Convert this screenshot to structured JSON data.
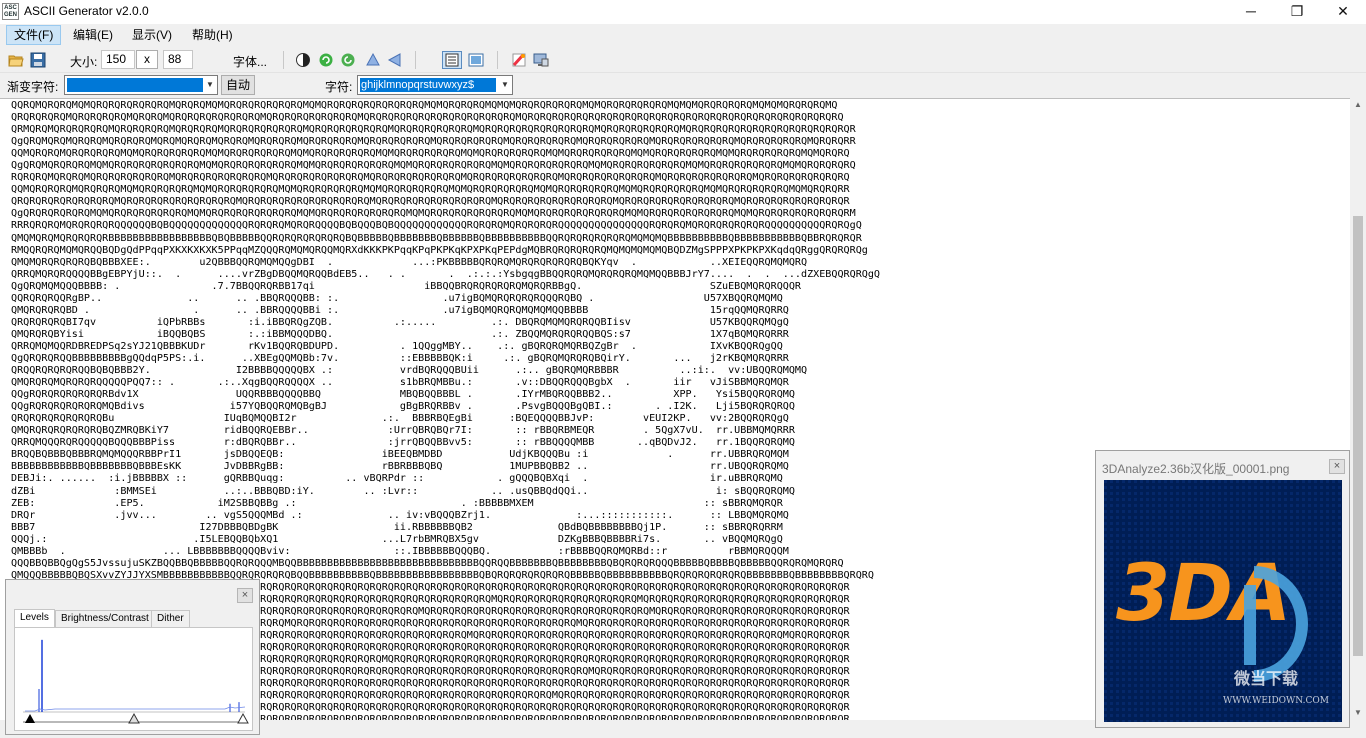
{
  "window": {
    "title": "ASCII Generator v2.0.0",
    "app_icon_text": "ASC GEN",
    "minimize": "─",
    "restore": "❐",
    "close": "✕"
  },
  "menu": {
    "file": "文件(F)",
    "edit": "编辑(E)",
    "view": "显示(V)",
    "help": "帮助(H)"
  },
  "toolbar": {
    "size_label": "大小:",
    "width": "150",
    "x_button": "x",
    "height": "88",
    "font_button": "字体..."
  },
  "toolbar2": {
    "ramp_label": "渐变字符:",
    "ramp_value": "",
    "auto_button": "自动",
    "chars_label": "字符:",
    "chars_value": "ghijklmnopqrstuvwxyz$"
  },
  "ascii": {
    "lines": [
      "QQRQMQRQRQMQMQRQRQRQRQRQRQMQRQRQMQMQRQRQRQRQRQRQMQMQRQRQRQRQRQRQRQRQMQMQRQRQRQMQMQMQRQRQRQRQRQMQMQRQRQRQRQRQMQMQMQRQRQRQRQMQMQMQRQRQRQMQ",
      "QRQRQRQRQMQRQRQRQRQMQRQRQMQRQRQRQRQRQRQRQMQRQRQRQRQRQRQRQMQRQRQRQRQRQRQRQRQRQRQRQRQMQRQRQRQRQRQRQRQRQRQRQRQRQRQRQRQRQRQRQRQRQRQRQRQRQRQRQ",
      "QRMQRQMQRQRQRQRQMQRQRQRQRQMQRQRQRQMQRQRQRQRQRQRQMQRQRQRQRQRQRQMQRQRQRQRQRQRQMQRQRQRQRQRQRQRQRQRQMQRQRQRQRQRQRQMQRQRQRQRQRQRQRQRQRQRQRQRQRQR",
      "QgQRQMQRQMQRQRQMQRQRQRQMQRQMQRQRQMQRQRQMQRQRQRQMQRQRQRQRQMQRQRQRQRQRQMQRQRQRQRQRQMQRQRQRQRQRQMQRQRQRQRQRQMQRQRQRQRQRQRQMQRQRQRQRQRQMQRQRQRR",
      "QQMQRQRQMQRQRQRQRQMQMQRQRQRQRQRQMQMQRQRQRQRQRQMQMQRQRQRQRQRQMQMQRQRQRQRQRQMQMQRQRQRQRQRQMQMQRQRQRQRQRQMQMQRQRQRQRQRQMQMQRQRQRQRQRQMQMQRQRQ",
      "QgQRQMQRQRQRQMQMQRQRQRQRQRQRQRQMQMQRQRQRQRQRQRQMQMQRQRQRQRQRQRQMQMQRQRQRQRQRQRQMQMQRQRQRQRQRQRQMQMQRQRQRQRQRQRQMQMQRQRQRQRQRQRQMQMQRQRQRQRQ",
      "RQRQRQMQRQRQMQRQRQRQRQRQRQMQRQRQRQRQRQRQRQMQRQRQRQRQRQRQRQMQRQRQRQRQRQRQRQMQRQRQRQRQRQRQRQMQRQRQRQRQRQRQRQMQRQRQRQRQRQRQRQMQRQRQRQRQRQRQRQ",
      "QQMQRQRQRQMQRQRQRQMQMQRQRQRQRQMQMQRQRQRQRQRQMQMQRQRQRQRQRQMQMQRQRQRQRQRQMQMQRQRQRQRQRQMQMQRQRQRQRQRQMQMQRQRQRQRQRQMQMQRQRQRQRQRQMQMQRQRQRR",
      "QRQRQRQRQRQRQRQRQMQRQRQRQRQRQRQRQRQRQMQRQRQRQRQRQRQRQRQRQRQMQRQRQRQRQRQRQRQRQRQMQRQRQRQRQRQRQRQRQRQMQRQRQRQRQRQRQRQRQRQMQRQRQRQRQRQRQRQRQR",
      "QgQRQRQRQRQRQMQMQRQRQRQRQRQRQMQMQRQRQRQRQRQRQRQMQMQRQRQRQRQRQRQRQMQMQRQRQRQRQRQRQRQMQMQRQRQRQRQRQRQRQMQMQRQRQRQRQRQRQRQMQMQRQRQRQRQRQRQRQRM",
      "RRRQRQRQMQRQRQRQRQQQQQQBQBQQQQQQQQQQQQQRQRQRQMQRQRQQQQBQBQQQBQBQQQQQQQQQQQQRQRQRQMQRQRQRQRQQQQQQQQQQQQQQQRQRQRQMQRQRQRQRQRQRQQQQQQQQQQRQRQgQ",
      "QMQMQRQMQRQRQRQRBBBBBBBBBBBBBBBBBQBQBBBBBQQRQRQRQRQRQRQBQBBBBBQBBBBBBBQBBBBBBQBBBBBBBBBBQQRQRQRQRQRQRQMQMQMQBBBBBBBBBBQBBBBBBBBBBBQBBRQRQRQR",
      "RMQQRQRQMQMQRQQBQDgQdPPqqPXKXKXKXK5PPqqMZQQQRQMQMQRQQMQRXdKKKPKPqqKPqPKPKqKPXPKqPEPdgMQBRQRQRQRQRQMQMQMQMQMQBQDZMgSPPPXPKPKPXKqdqQRggQRQRQRQg",
      "QMQMQRQRQRQRQBQBBBXEE:.        u2QBBBQQRQMQMQQgDBI  .             ...:PKBBBBBQRQRQMQRQRQRQRQRQBQKYqv  .            ..XEIEQQRQMQMQRQ",
      "QRRQMQRQRQQQQBBgEBPYjU::.  .      ....vrZBgDBQQMQRQQBdEB5..   . .       .  .:.:.:YsbgqgBBQQRQRQMQRQRQRQMQMQQBBBJrY7....  .  .  ...dZXEBQQRQRQgQ",
      "QgQRQMQMQQQBBBB: .               .7.7BBQQRQRBB17qi                  iBBQQBRQRQRQRQRQMQRQRBBgQ.                     SZuEBQMQRQRQQQR",
      "QQRQRQRQQRgBP..              ..      .. .BBQRQQQBB: :.                 .u7igBQMQRQRQRQRQQQRQBQ .                  U57XBQQRQMQMQ",
      "QMQRQRQRQBD .                 .      .. .BBRQQQQBBi :.                 .u7igBQMQRQRQMQMQMQQBBBB                    15rqQQMQRQRRQ",
      "QRQRQRQRQBI7qv          iQPbRBBs       :i.iBBQRQgZQB.          .:.....         .:. DBQRQMQMQRQRQQBIisv             U57KBQQRQMQgQ",
      "QMQRQRQBYisi            iBQQBQBS       :.:iBBMQQQDBQ.                          .:. ZBQQMQRQRQRQQBQS:s7             1X7qBQMQRQRRR",
      "QRRQMQMQQRDBREDPSq2sYJ21QBBBKUDr       rKv1BQQRQBDUPD.          . 1QQggMBY..    .:. gBQRQRQMQRBQZgBr  .            IXvKBQQRQgQQ",
      "QgQRQRQRQQBBBBBBBBBgQQdqP5PS:.i.      ..XBEgQQMQBb:7v.          ::EBBBBBQK:i     .:. gBQRQMQRQRQBQirY.       ...   j2rKBQMQRQRRR",
      "QRQQRQRQRQRQQBQBQBBB2Y.              I2BBBBQQQQQBX .:           vrdBQRQQQBUii      .:.. gBQRQMQRBBBR          ..:i:.  vv:UBQQRQMQMQ",
      "QMQRQRQMQRQRQRQQQQQPQQ7:: .       .:..XqgBQQRQQQQX ..           s1bBRQMBBu.:       .v::DBQQRQQQBgbX  .       iir   vJiSBBMQRQMQR",
      "QQgRQRQRQRQRQRQRBdv1X                UQQRBBBQQQQBBQ             MBQBQQBBBL .       .IYrMBQRQQBBB2..          XPP.   Ysi5BQQRQRQMQ",
      "QQgRQRQRQRQRQRQMQBdivs              i57YQBQQRQMQBgBJ            gBgBRQRBBv .       .PsvgBQQQBgQBI.:       . .I2K.   Lji5BQRQRQRQQ",
      "QRQRQRQRQRQRQRQBu                  IUqBQMQQBI2r              .:.  BBBRBQEgBi      :BQEQQQQBBJvP:        vEUI2KP.   vv:2BQQRQRQgQ",
      "QMQRQRQRQRQRQRQBQZMRQBKiY7         ridBQQRQEBBr..             :UrrQBRQBQr7I:       :: rBBQRBMEQR        . 5QgX7vU.  rr.UBBMQMQRRR",
      "QRRQMQQQRQRQQQQQBQQQBBBPiss        r:dBQRQBBr..               :jrrQBQQBBvv5:       :: rBBQQQQMBB       ..qBQDvJ2.   rr.1BQQRQRQMQ",
      "BRQQBQBBBQBBBRQMQMQQQRBBPrI1       jsDBQQEQB:                iBEEQBMDBD           UdjKBQQQBu :i             .      rr.UBBRQRQMQM",
      "BBBBBBBBBBBBQBBBBBBBQBBBEsKK       JvDBBRgBB:                rBBRBBBQBQ           1MUPBBQBB2 ..                    rr.UBQQRQRQMQ",
      "DEBJi:. ......  :i.jBBBBBX ::      gQRBBQuqg:          .. vBQRPdr ::            . gQQQBQBXqi  .                    ir.uBBRQRQMQ",
      "dZBi             :BMMSEi           ..:..BBBQBD:iY.        .. :Lvr::            .. .usQBBQdQQi..                     i: sBQQRQRQMQ",
      "ZEB:             .EP5.            iM2SBBQBBg .:                           . :BBBBBMXEM                            :: sBBRQMQRQR",
      "DRQr             .jvv...        .. vgS5QQQMBd .:              .. iv:vBQQQBZrj1.              :...:::::::::::.      :: LBBQMQRQMQ",
      "BBB7                           I27DBBBQBDgBK                   ii.RBBBBBBQB2              QBdBQBBBBBBBBQj1P.      :: sBBRQRQRRM",
      "QQQj.:                        .I5LEBQQBQbXQ1                 ...L7rbBMRQBX5gv             DZKgBBBQBBBBRi7s.       .. vBQQMQRQgQ",
      "QMBBBb  .                ... LBBBBBBBQQQQBviv:                 ::.IBBBBBBQQQBQ.           :rBBBBQQRQMQRBd::r          rBBMQRQQQM",
      "QQQBBQBBQgQgS5JvssujuSKZBQQBBQBBBBBQQRQRQQQMBQQBBBBBBBBBBBBBBBBBBBBBBBBBBBBBBQQRQQBBBBBBBQBBBBBBBBQBQRQRQRQQQBBBBBQBBBBQBBBBBQQRQRQMQRQRQ",
      "QMQQQBBBBBQBQSXvvZYJJYXSMBBBBBBBBBBBQQRQRQRQRQBQQBBBBBBBBBBQBBBBBBBBBBBBBBBBBQBQRQRQRQRQRQRQBBBBBQBBBBBBBBBBQRQRQRQRQRQRQBBBBBBBQBBBBBBBBQRQRQ",
      "QRQRQRQRQRQRQRQRQRQRQRQRQRQRQRQRQRQRQRQRQRQRQRQRQRQRQRQRQRQRQRQRQRQRQRQRQRQRQRQRQRQRQRQRQRQRQRQRQRQRQRQRQRQRQRQRQRQRQRQRQRQRQRQRQRQRQRQRQR",
      "QRQRQMQRQRQRQRQRQRQRQRQRQRQMQRQRQRQRQRQRQRQRQRQRQRQRQRQRQRQRQRQRQRQRQRQRQRQRQRQMQRQRQRQRQRQRQRQRQRQRQRQMQRQRQRQRQRQRQRQRQRQRQRQRQRQRQRQRQR",
      "QRQRQRQRQMQRQRQRQRQRQRQRQRQRQRQMQRQRQRQRQRQRQRQRQRQRQRQRQRQRQRQRQRQMQRQRQRQRQRQRQRQRQRQRQRQRQRQRQRQRQRQRQMQRQRQRQRQRQRQRQRQRQRQRQRQRQRQRQR",
      "QRQRQRQRQRQRQRQMQRQRQRQRQRQRQRQRQRQRQRQRQRQRQMQRQRQRQRQRQRQRQRQRQRQRQRQRQRQRQRQRQRQRQRQRQRQRQMQRQRQRQRQRQRQRQRQRQRQRQRQRQRQRQRQRQRQRQRQRQR",
      "QRQRQRQRQRQRQRQRQRQRQRQMQRQRQRQRQRQRQRQRQRQRQRQRQRQRQRQRQRQRQRQRQRQRQRQRQRQMQRQRQRQRQRQRQRQRQRQRQRQRQRQRQRQRQRQRQRQRQRQRQRQRQRQMQRQRQRQRQR",
      "QRQRQRQRQRQRQRQRQRQRQRQRQRQRQRQRQRQMQRQRQRQRQRQRQRQRQRQRQRQRQRQRQRQRQRQRQRQRQRQRQRQRQRQRQRQRQRQRQRQRQRQRQRQRQRQRQRQRQRQRQRQRQRQRQRQRQRQRQR",
      "QRQRQRQRQRQRQMQRQRQRQRQRQRQRQRQRQRQRQRQRQRQRQRQRQRQRQRQRQRQRQMQRQRQRQRQRQRQRQRQRQRQRQRQRQRQRQRQRQRQRQRQRQRQRQRQRQRQRQRQRQRQRQRQRQRQRQRQRQR",
      "QRQRQRQRQRQRQRQRQRQRQRQRQRQRQRQRQRQRQRQRQRQRQRQRQRQRQRQRQRQRQRQRQRQRQRQRQRQRQRQRQRQRQRQRQRQRQRQMQRQRQRQRQRQRQRQRQRQRQRQRQRQRQRQRQRQRQRQRQR",
      "QRQRQRQRQRQRQRQRQRQRQRQRQRQMQRQRQRQRQRQRQRQRQRQRQRQRQRQRQRQRQRQRQRQRQRQRQRQRQRQRQRQRQRQRQRQRQRQRQRQRQRQRQRQRQRQRQRQRQRQRQRQRQRQRQRQRQRQRQR",
      "QRQRQRQRQRQRQRQRQRQRQRQRQRQRQRQRQRQRQRQRQRQRQRQRQRQRQRQRQRQRQRQRQRQRQRQRQRQRQRQRQRQRQRQRQMQRQRQRQRQRQRQRQRQRQRQRQRQRQRQRQRQRQRQRQRQRQRQRQR",
      "QRQRQRQRQRQRQRQRQRQRQRQRQRQRQRQRQRQRQRQRQRQRQRQRQRQRQRQRQRQRQRQRQRQRQRQRQRQRQRQRQRQRQRQRQRQRQRQRQRQRQRQRQRQRQRQRQRQRQRQRQRQRQRQRQRQRQRQRQR",
      "QRQRQRQRQRQRQRQRQRQRQRQRQRQRQRQRQRQRQRQRQRQRQRQRQRQRQRQRQRQRQRQRQRQRQRQRQRQRQRQRQRQRQRQRQRQRQRQRQRQRQRQRQRQRQRQRQRQRQRQRQRQRQRQRQRQRQRQRQR"
    ]
  },
  "levels_panel": {
    "close": "×",
    "tabs": [
      "Levels",
      "Brightness/Contrast",
      "Dither"
    ],
    "active_tab": 0,
    "histogram_peaks": [
      0.88,
      0.28,
      0.1,
      0.12
    ]
  },
  "preview_panel": {
    "title": "3DAnalyze2.36b汉化版_00001.png",
    "close": "×",
    "logo_text": "3DA",
    "watermark_cn": "微当下载",
    "watermark_en": "WWW.WEIDOWN.COM"
  },
  "colors": {
    "accent": "#0078d7",
    "logo_orange": "#f7941d",
    "logo_bg": "#001e55",
    "watermark_blue": "#4aa3df",
    "histogram_blue": "#1a3fd8"
  }
}
